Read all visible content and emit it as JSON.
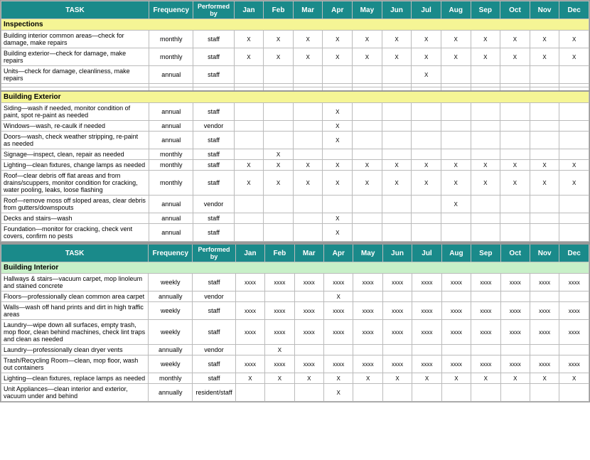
{
  "table1": {
    "headers": {
      "task": "TASK",
      "frequency": "Frequency",
      "performed_by": "Performed by",
      "months": [
        "Jan",
        "Feb",
        "Mar",
        "Apr",
        "May",
        "Jun",
        "Jul",
        "Aug",
        "Sep",
        "Oct",
        "Nov",
        "Dec"
      ]
    },
    "sections": [
      {
        "name": "Inspections",
        "type": "yellow",
        "rows": [
          {
            "task": "Building interior common areas—check for damage, make repairs",
            "freq": "monthly",
            "perf": "staff",
            "marks": {
              "Jan": "X",
              "Feb": "X",
              "Mar": "X",
              "Apr": "X",
              "May": "X",
              "Jun": "X",
              "Jul": "X",
              "Aug": "X",
              "Sep": "X",
              "Oct": "X",
              "Nov": "X",
              "Dec": "X"
            }
          },
          {
            "task": "Building exterior—check for damage, make repairs",
            "freq": "monthly",
            "perf": "staff",
            "marks": {
              "Jan": "X",
              "Feb": "X",
              "Mar": "X",
              "Apr": "X",
              "May": "X",
              "Jun": "X",
              "Jul": "X",
              "Aug": "X",
              "Sep": "X",
              "Oct": "X",
              "Nov": "X",
              "Dec": "X"
            }
          },
          {
            "task": "Units—check for damage, cleanliness, make repairs",
            "freq": "annual",
            "perf": "staff",
            "marks": {
              "Jul": "X"
            }
          },
          {
            "task": "",
            "freq": "",
            "perf": "",
            "marks": {}
          },
          {
            "task": "",
            "freq": "",
            "perf": "",
            "marks": {}
          }
        ]
      },
      {
        "name": "Building Exterior",
        "type": "yellow",
        "rows": [
          {
            "task": "Siding—wash if needed, monitor condition of paint, spot re-paint as needed",
            "freq": "annual",
            "perf": "staff",
            "marks": {
              "Apr": "X"
            }
          },
          {
            "task": "Windows—wash, re-caulk if needed",
            "freq": "annual",
            "perf": "vendor",
            "marks": {
              "Apr": "X"
            }
          },
          {
            "task": "Doors—wash, check weather stripping, re-paint as needed",
            "freq": "annual",
            "perf": "staff",
            "marks": {
              "Apr": "X"
            }
          },
          {
            "task": "Signage—inspect, clean, repair as needed",
            "freq": "monthly",
            "perf": "staff",
            "marks": {
              "Feb": "X"
            }
          },
          {
            "task": "Lighting—clean fixtures, change lamps as needed",
            "freq": "monthly",
            "perf": "staff",
            "marks": {
              "Jan": "X",
              "Feb": "X",
              "Mar": "X",
              "Apr": "X",
              "May": "X",
              "Jun": "X",
              "Jul": "X",
              "Aug": "X",
              "Sep": "X",
              "Oct": "X",
              "Nov": "X",
              "Dec": "X"
            }
          },
          {
            "task": "Roof—clear debris off flat areas and from drains/scuppers, monitor condition for cracking, water pooling, leaks, loose flashing",
            "freq": "monthly",
            "perf": "staff",
            "marks": {
              "Jan": "X",
              "Feb": "X",
              "Mar": "X",
              "Apr": "X",
              "May": "X",
              "Jun": "X",
              "Jul": "X",
              "Aug": "X",
              "Sep": "X",
              "Oct": "X",
              "Nov": "X",
              "Dec": "X"
            }
          },
          {
            "task": "Roof—remove moss off sloped areas, clear debris from gutters/downspouts",
            "freq": "annual",
            "perf": "vendor",
            "marks": {
              "Aug": "X"
            }
          },
          {
            "task": "Decks and stairs—wash",
            "freq": "annual",
            "perf": "staff",
            "marks": {
              "Apr": "X"
            }
          },
          {
            "task": "Foundation—monitor for cracking, check vent covers, confirm no pests",
            "freq": "annual",
            "perf": "staff",
            "marks": {
              "Apr": "X"
            }
          }
        ]
      }
    ]
  },
  "table2": {
    "headers": {
      "task": "TASK",
      "frequency": "Frequency",
      "performed_by": "Performed by",
      "months": [
        "Jan",
        "Feb",
        "Mar",
        "Apr",
        "May",
        "Jun",
        "Jul",
        "Aug",
        "Sep",
        "Oct",
        "Nov",
        "Dec"
      ]
    },
    "sections": [
      {
        "name": "Building Interior",
        "type": "green",
        "rows": [
          {
            "task": "Hallways & stairs—vacuum carpet, mop linoleum and stained concrete",
            "freq": "weekly",
            "perf": "staff",
            "marks": {
              "Jan": "xxxx",
              "Feb": "xxxx",
              "Mar": "xxxx",
              "Apr": "xxxx",
              "May": "xxxx",
              "Jun": "xxxx",
              "Jul": "xxxx",
              "Aug": "xxxx",
              "Sep": "xxxx",
              "Oct": "xxxx",
              "Nov": "xxxx",
              "Dec": "xxxx"
            }
          },
          {
            "task": "Floors—professionally clean common area carpet",
            "freq": "annually",
            "perf": "vendor",
            "marks": {
              "Apr": "X"
            }
          },
          {
            "task": "Walls—wash off hand prints and dirt in high traffic areas",
            "freq": "weekly",
            "perf": "staff",
            "marks": {
              "Jan": "xxxx",
              "Feb": "xxxx",
              "Mar": "xxxx",
              "Apr": "xxxx",
              "May": "xxxx",
              "Jun": "xxxx",
              "Jul": "xxxx",
              "Aug": "xxxx",
              "Sep": "xxxx",
              "Oct": "xxxx",
              "Nov": "xxxx",
              "Dec": "xxxx"
            }
          },
          {
            "task": "Laundry—wipe down all surfaces, empty trash, mop floor, clean behind machines, check lint traps and clean as needed",
            "freq": "weekly",
            "perf": "staff",
            "marks": {
              "Jan": "xxxx",
              "Feb": "xxxx",
              "Mar": "xxxx",
              "Apr": "xxxx",
              "May": "xxxx",
              "Jun": "xxxx",
              "Jul": "xxxx",
              "Aug": "xxxx",
              "Sep": "xxxx",
              "Oct": "xxxx",
              "Nov": "xxxx",
              "Dec": "xxxx"
            }
          },
          {
            "task": "Laundry—professionally clean dryer vents",
            "freq": "annually",
            "perf": "vendor",
            "marks": {
              "Feb": "X"
            }
          },
          {
            "task": "Trash/Recycling Room—clean, mop floor, wash out containers",
            "freq": "weekly",
            "perf": "staff",
            "marks": {
              "Jan": "xxxx",
              "Feb": "xxxx",
              "Mar": "xxxx",
              "Apr": "xxxx",
              "May": "xxxx",
              "Jun": "xxxx",
              "Jul": "xxxx",
              "Aug": "xxxx",
              "Sep": "xxxx",
              "Oct": "xxxx",
              "Nov": "xxxx",
              "Dec": "xxxx"
            }
          },
          {
            "task": "Lighting—clean fixtures, replace lamps as needed",
            "freq": "monthly",
            "perf": "staff",
            "marks": {
              "Jan": "X",
              "Feb": "X",
              "Mar": "X",
              "Apr": "X",
              "May": "X",
              "Jun": "X",
              "Jul": "X",
              "Aug": "X",
              "Sep": "X",
              "Oct": "X",
              "Nov": "X",
              "Dec": "X"
            }
          },
          {
            "task": "Unit Appliances—clean interior and exterior, vacuum under and behind",
            "freq": "annually",
            "perf": "resident/staff",
            "marks": {
              "Apr": "X"
            }
          }
        ]
      }
    ]
  }
}
